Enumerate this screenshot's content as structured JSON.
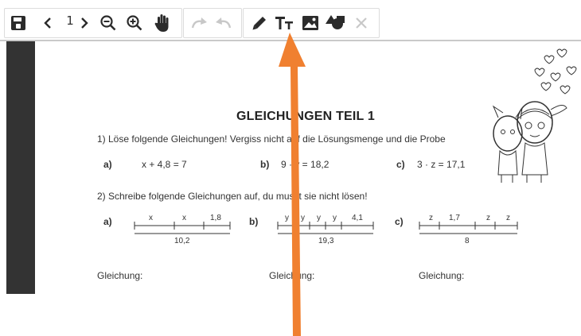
{
  "toolbar": {
    "page_number": "1",
    "icons": [
      "save-icon",
      "chevron-left-icon",
      "chevron-right-icon",
      "zoom-out-icon",
      "zoom-in-icon",
      "hand-pan-icon",
      "redo-icon",
      "undo-icon",
      "pencil-icon",
      "text-size-icon",
      "image-icon",
      "shapes-icon",
      "close-icon"
    ]
  },
  "worksheet": {
    "title": "GLEICHUNGEN TEIL 1",
    "task1": "1) Löse folgende Gleichungen! Vergiss nicht auf die Lösungsmenge und die Probe",
    "eq_a_label": "a)",
    "eq_a": "x + 4,8 = 7",
    "eq_b_label": "b)",
    "eq_b": "9 · y = 18,2",
    "eq_c_label": "c)",
    "eq_c": "3 · z = 17,1",
    "task2": "2) Schreibe folgende Gleichungen auf, du musst sie nicht lösen!",
    "diag_a_label": "a)",
    "diag_a_top": [
      "x",
      "x",
      "1,8"
    ],
    "diag_a_total": "10,2",
    "diag_b_label": "b)",
    "diag_b_top": [
      "y",
      "y",
      "y",
      "y",
      "4,1"
    ],
    "diag_b_total": "19,3",
    "diag_c_label": "c)",
    "diag_c_top": [
      "z",
      "1,7",
      "z",
      "z"
    ],
    "diag_c_total": "8",
    "gleichung_a": "Gleichung:",
    "gleichung_b": "Gleichung:",
    "gleichung_c": "Gleichung:"
  },
  "colors": {
    "arrow": "#f08030",
    "dark_bar": "#333333",
    "icon": "#2b2b2b",
    "icon_disabled": "#c8c8c8"
  }
}
